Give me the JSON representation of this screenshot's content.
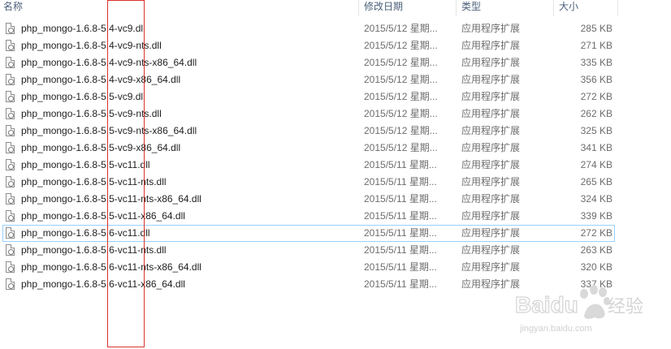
{
  "header": {
    "name": "名称",
    "date": "修改日期",
    "type": "类型",
    "size": "大小"
  },
  "files": [
    {
      "name": "php_mongo-1.6.8-5.4-vc9.dll",
      "date": "2015/5/12 星期...",
      "type": "应用程序扩展",
      "size": "285 KB"
    },
    {
      "name": "php_mongo-1.6.8-5.4-vc9-nts.dll",
      "date": "2015/5/12 星期...",
      "type": "应用程序扩展",
      "size": "271 KB"
    },
    {
      "name": "php_mongo-1.6.8-5.4-vc9-nts-x86_64.dll",
      "date": "2015/5/12 星期...",
      "type": "应用程序扩展",
      "size": "335 KB"
    },
    {
      "name": "php_mongo-1.6.8-5.4-vc9-x86_64.dll",
      "date": "2015/5/12 星期...",
      "type": "应用程序扩展",
      "size": "356 KB"
    },
    {
      "name": "php_mongo-1.6.8-5.5-vc9.dll",
      "date": "2015/5/12 星期...",
      "type": "应用程序扩展",
      "size": "272 KB"
    },
    {
      "name": "php_mongo-1.6.8-5.5-vc9-nts.dll",
      "date": "2015/5/12 星期...",
      "type": "应用程序扩展",
      "size": "262 KB"
    },
    {
      "name": "php_mongo-1.6.8-5.5-vc9-nts-x86_64.dll",
      "date": "2015/5/12 星期...",
      "type": "应用程序扩展",
      "size": "325 KB"
    },
    {
      "name": "php_mongo-1.6.8-5.5-vc9-x86_64.dll",
      "date": "2015/5/12 星期...",
      "type": "应用程序扩展",
      "size": "341 KB"
    },
    {
      "name": "php_mongo-1.6.8-5.5-vc11.dll",
      "date": "2015/5/11 星期...",
      "type": "应用程序扩展",
      "size": "274 KB"
    },
    {
      "name": "php_mongo-1.6.8-5.5-vc11-nts.dll",
      "date": "2015/5/11 星期...",
      "type": "应用程序扩展",
      "size": "265 KB"
    },
    {
      "name": "php_mongo-1.6.8-5.5-vc11-nts-x86_64.dll",
      "date": "2015/5/11 星期...",
      "type": "应用程序扩展",
      "size": "324 KB"
    },
    {
      "name": "php_mongo-1.6.8-5.5-vc11-x86_64.dll",
      "date": "2015/5/11 星期...",
      "type": "应用程序扩展",
      "size": "339 KB"
    },
    {
      "name": "php_mongo-1.6.8-5.6-vc11.dll",
      "date": "2015/5/11 星期...",
      "type": "应用程序扩展",
      "size": "272 KB",
      "focused": true
    },
    {
      "name": "php_mongo-1.6.8-5.6-vc11-nts.dll",
      "date": "2015/5/11 星期...",
      "type": "应用程序扩展",
      "size": "263 KB"
    },
    {
      "name": "php_mongo-1.6.8-5.6-vc11-nts-x86_64.dll",
      "date": "2015/5/11 星期...",
      "type": "应用程序扩展",
      "size": "320 KB"
    },
    {
      "name": "php_mongo-1.6.8-5.6-vc11-x86_64.dll",
      "date": "2015/5/11 星期...",
      "type": "应用程序扩展",
      "size": "337 KB"
    }
  ],
  "annotation": {
    "color": "#d9322b"
  },
  "watermark": {
    "brand": "Baidu",
    "cn": "经验",
    "url": "jingyan.baidu.com"
  },
  "icons": {
    "file": "dll-file-icon",
    "paw": "baidu-paw-icon"
  }
}
